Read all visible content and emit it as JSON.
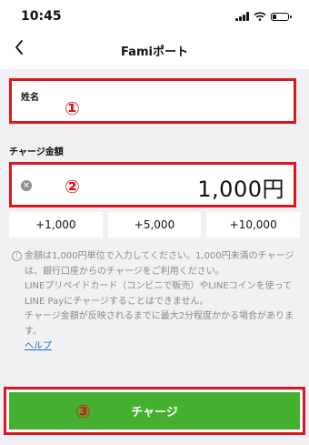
{
  "status_bar": {
    "time": "10:45"
  },
  "nav": {
    "title": "Famiポート"
  },
  "form": {
    "name_label": "姓名",
    "amount_section_label": "チャージ金額",
    "amount_value": "1,000円"
  },
  "markers": {
    "one": "①",
    "two": "②",
    "three": "③"
  },
  "quick_amounts": [
    "+1,000",
    "+5,000",
    "+10,000"
  ],
  "notice": {
    "line1": "金額は1,000円単位で入力してください。1,000円未満のチャージは、銀行口座からのチャージをご利用ください。",
    "line2": "LINEプリペイドカード（コンビニで販売）やLINEコインを使ってLINE Payにチャージすることはできません。",
    "line3": "チャージ金額が反映されるまでに最大2分程度かかる場合があります。",
    "help_link": "ヘルプ"
  },
  "charge_button": {
    "label": "チャージ"
  },
  "colors": {
    "accent_green": "#45b02f",
    "highlight_red": "#e0141e",
    "link_blue": "#1a66cc"
  },
  "icons": [
    "chevron-left-icon",
    "clear-icon",
    "info-icon",
    "signal-icon",
    "wifi-icon",
    "battery-icon"
  ]
}
